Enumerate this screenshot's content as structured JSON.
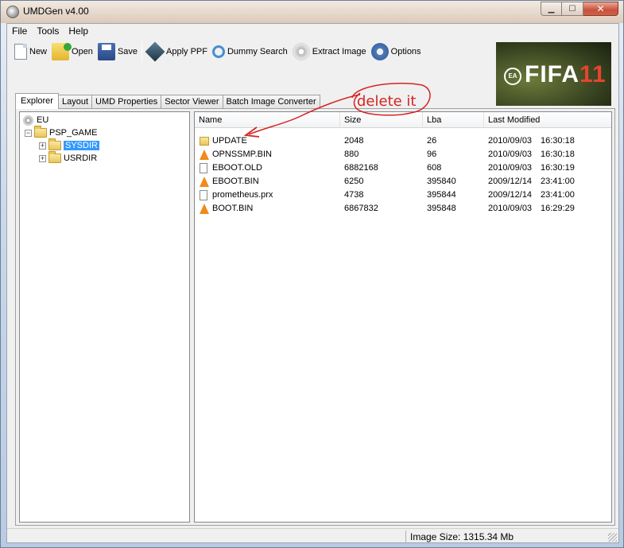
{
  "window": {
    "title": "UMDGen v4.00",
    "controls": {
      "min": "▁",
      "max": "☐",
      "close": "✕"
    }
  },
  "menu": [
    "File",
    "Tools",
    "Help"
  ],
  "toolbar": {
    "new": "New",
    "open": "Open",
    "save": "Save",
    "apply_ppf": "Apply PPF",
    "dummy_search": "Dummy Search",
    "extract_image": "Extract Image",
    "options": "Options"
  },
  "banner": {
    "ea": "EA",
    "title": "FIFA",
    "number": "11"
  },
  "tabs": [
    "Explorer",
    "Layout",
    "UMD Properties",
    "Sector Viewer",
    "Batch Image Converter"
  ],
  "tree": {
    "root": "EU",
    "psp_game": "PSP_GAME",
    "sysdir": "SYSDIR",
    "usrdir": "USRDIR",
    "collapse_symbol": "−",
    "expand_symbol": "+"
  },
  "list": {
    "columns": [
      "Name",
      "Size",
      "Lba",
      "Last Modified"
    ],
    "rows": [
      {
        "icon": "folder-icon",
        "name": "UPDATE",
        "size": "2048",
        "lba": "26",
        "date": "2010/09/03",
        "time": "16:30:18"
      },
      {
        "icon": "vlc-cone-icon",
        "name": "OPNSSMP.BIN",
        "size": "880",
        "lba": "96",
        "date": "2010/09/03",
        "time": "16:30:18"
      },
      {
        "icon": "file-icon",
        "name": "EBOOT.OLD",
        "size": "6882168",
        "lba": "608",
        "date": "2010/09/03",
        "time": "16:30:19"
      },
      {
        "icon": "vlc-cone-icon",
        "name": "EBOOT.BIN",
        "size": "6250",
        "lba": "395840",
        "date": "2009/12/14",
        "time": "23:41:00"
      },
      {
        "icon": "file-icon",
        "name": "prometheus.prx",
        "size": "4738",
        "lba": "395844",
        "date": "2009/12/14",
        "time": "23:41:00"
      },
      {
        "icon": "vlc-cone-icon",
        "name": "BOOT.BIN",
        "size": "6867832",
        "lba": "395848",
        "date": "2010/09/03",
        "time": "16:29:29"
      }
    ]
  },
  "annotation": {
    "text": "delete it",
    "color": "#d42424"
  },
  "status": {
    "image_size": "Image Size: 1315.34 Mb"
  }
}
